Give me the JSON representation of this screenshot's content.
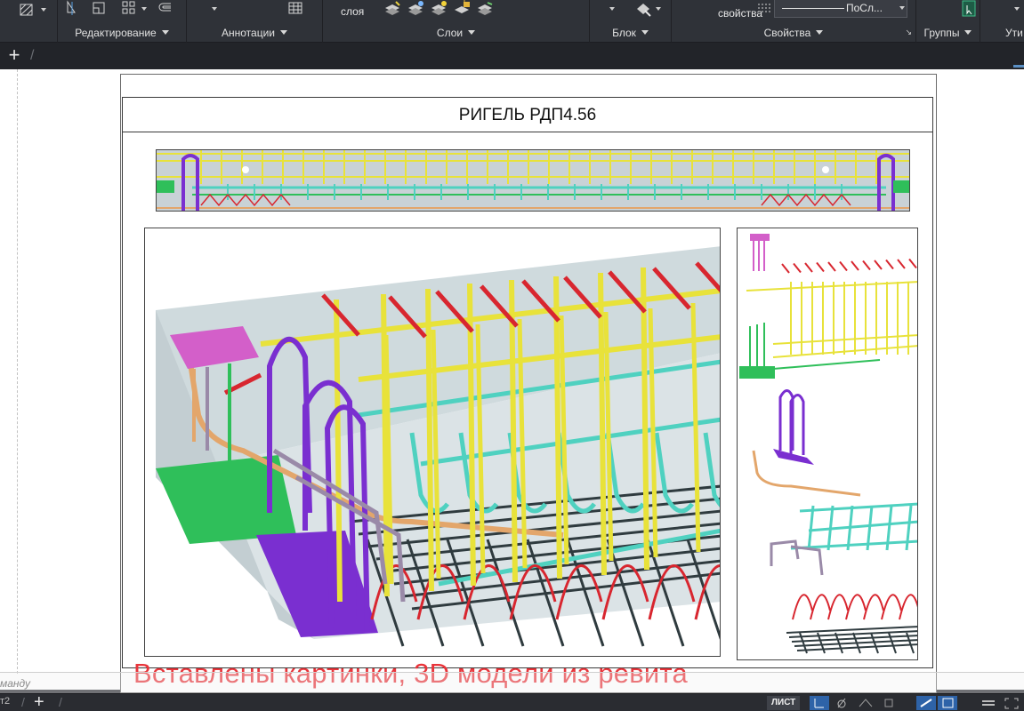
{
  "ribbon": {
    "panels": [
      {
        "id": "edit",
        "label": "Редактирование"
      },
      {
        "id": "annot",
        "label": "Аннотации"
      },
      {
        "id": "layers",
        "label": "Слои"
      },
      {
        "id": "block",
        "label": "Блок"
      },
      {
        "id": "props",
        "label": "Свойства"
      },
      {
        "id": "groups",
        "label": "Группы"
      },
      {
        "id": "util",
        "label": "Ути"
      }
    ],
    "layers_button_label": "слоя",
    "props_button_label": "свойства",
    "lineweight_value": "ПоСл..."
  },
  "tabs": {
    "new_tab": "+"
  },
  "drawing": {
    "sheet_title": "РИГЕЛЬ РДП4.56",
    "annotation": "Вставлены картинки, 3D модели из ревита"
  },
  "command_line": {
    "input_text": "манду"
  },
  "status": {
    "layout_prev": "т2",
    "add_layout": "+",
    "sheet_badge": "ЛИСТ"
  },
  "colors": {
    "ribbon_bg": "#2f3238",
    "stirrup_yellow": "#e8e23a",
    "tie_red": "#d8262f",
    "mesh_cyan": "#4fd1c0",
    "plate_magenta": "#d35fc9",
    "bar_purple": "#7a2fd0",
    "base_green": "#2fbf5a",
    "bar_tan": "#e3a66b",
    "annotation_red": "#e8343a"
  }
}
